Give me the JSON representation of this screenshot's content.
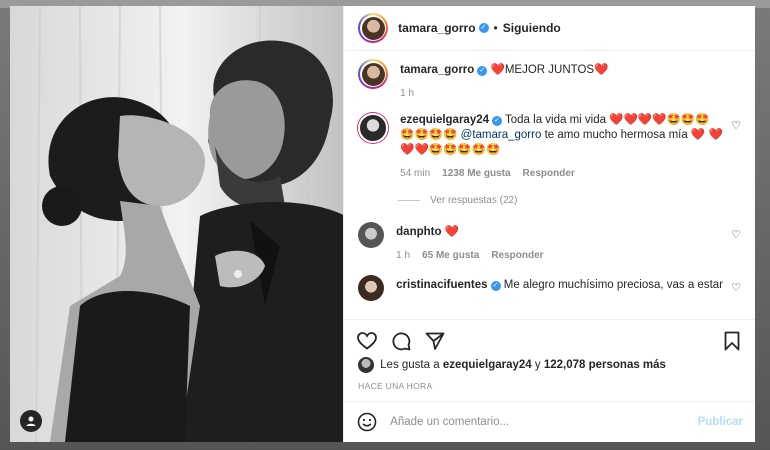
{
  "header": {
    "username": "tamara_gorro",
    "separator": "•",
    "follow_label": "Siguiendo"
  },
  "caption": {
    "username": "tamara_gorro",
    "heart_before": "❤️",
    "text": "MEJOR JUNTOS",
    "heart_after": "❤️",
    "time": "1 h"
  },
  "comments": [
    {
      "username": "ezequielgaray24",
      "text_part1": "Toda la vida mi vida ❤️❤️❤️❤️🤩🤩🤩",
      "text_part2": "🤩🤩🤩🤩",
      "mention": "@tamara_gorro",
      "text_part3": "te amo mucho hermosa mía ❤️",
      "text_part4": "❤️❤️❤️🤩🤩🤩🤩🤩",
      "time": "54 min",
      "likes": "1238 Me gusta",
      "reply": "Responder",
      "view_replies": "Ver respuestas (22)"
    },
    {
      "username": "danphto",
      "text": "❤️",
      "time": "1 h",
      "likes": "65 Me gusta",
      "reply": "Responder"
    },
    {
      "username": "cristinacifuentes",
      "text": "Me alegro muchísimo preciosa, vas a estar"
    }
  ],
  "likes_line": {
    "prefix": "Les gusta a",
    "user": "ezequielgaray24",
    "connector": "y",
    "count": "122,078 personas más"
  },
  "time_ago": "HACE UNA HORA",
  "add_comment": {
    "placeholder": "Añade un comentario...",
    "post_label": "Publicar"
  },
  "colors": {
    "verified": "#3897f0",
    "heart": "#ed4956",
    "post_disabled": "#b2dffc"
  },
  "icons": {
    "like": "heart-outline-icon",
    "comment": "speech-bubble-icon",
    "share": "paper-plane-icon",
    "save": "bookmark-icon",
    "emoji": "smiley-icon",
    "tag": "user-tag-icon"
  }
}
